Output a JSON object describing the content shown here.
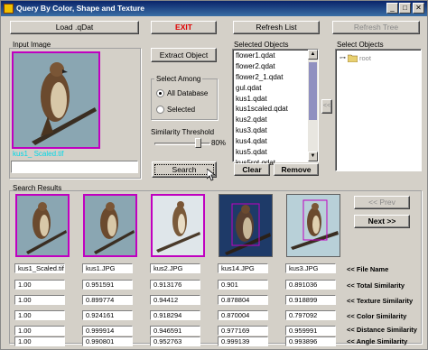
{
  "window": {
    "title": "Query By Color, Shape and Texture"
  },
  "toolbar": {
    "load_label": "Load .qDat",
    "exit_label": "EXIT",
    "refresh_list_label": "Refresh List",
    "refresh_tree_label": "Refresh Tree"
  },
  "input_image": {
    "label": "Input Image",
    "caption": "kus1_ Scaled.tif",
    "path_value": ""
  },
  "extract_label": "Extract Object",
  "select_among": {
    "title": "Select Among",
    "options": [
      "All Database",
      "Selected"
    ],
    "selected": "All Database"
  },
  "similarity": {
    "label": "Similarity Threshold",
    "value": "80%",
    "level": 0.8
  },
  "search_label": "Search",
  "selected_objects": {
    "label": "Selected Objects",
    "items": [
      "flower1.qdat",
      "flower2.qdat",
      "flower2_1.qdat",
      "gul.qdat",
      "kus1.qdat",
      "kus1scaled.qdat",
      "kus2.qdat",
      "kus3.qdat",
      "kus4.qdat",
      "kus5.qdat",
      "kus5rot.qdat"
    ],
    "clear_label": "Clear",
    "remove_label": "Remove",
    "move_arrow": "<<"
  },
  "select_objects": {
    "label": "Select Objects",
    "tree_root": "root"
  },
  "search_results": {
    "label": "Search Results",
    "prev_label": "<< Prev",
    "next_label": "Next >>",
    "columns": [
      {
        "file": "kus1_Scaled.tif",
        "total": "1.00",
        "texture": "1.00",
        "color": "1.00",
        "distance": "1.00",
        "angle": "1.00"
      },
      {
        "file": "kus1.JPG",
        "total": "0.951591",
        "texture": "0.899774",
        "color": "0.924161",
        "distance": "0.999914",
        "angle": "0.990801"
      },
      {
        "file": "kus2.JPG",
        "total": "0.913176",
        "texture": "0.94412",
        "color": "0.918294",
        "distance": "0.946591",
        "angle": "0.952763"
      },
      {
        "file": "kus14.JPG",
        "total": "0.901",
        "texture": "0.878804",
        "color": "0.870004",
        "distance": "0.977169",
        "angle": "0.999139"
      },
      {
        "file": "kus3.JPG",
        "total": "0.891036",
        "texture": "0.918899",
        "color": "0.797092",
        "distance": "0.959991",
        "angle": "0.993896"
      }
    ],
    "row_labels": {
      "file": "<< File Name",
      "total": "<< Total Similarity",
      "texture": "<< Texture Similarity",
      "color": "<< Color Similarity",
      "distance": "<< Distance Similarity",
      "angle": "<< Angle Similarity"
    }
  },
  "colors": {
    "highlight_frame": "#c000c0",
    "exit_text": "#e00000",
    "caption_cyan": "#00d8e8"
  }
}
